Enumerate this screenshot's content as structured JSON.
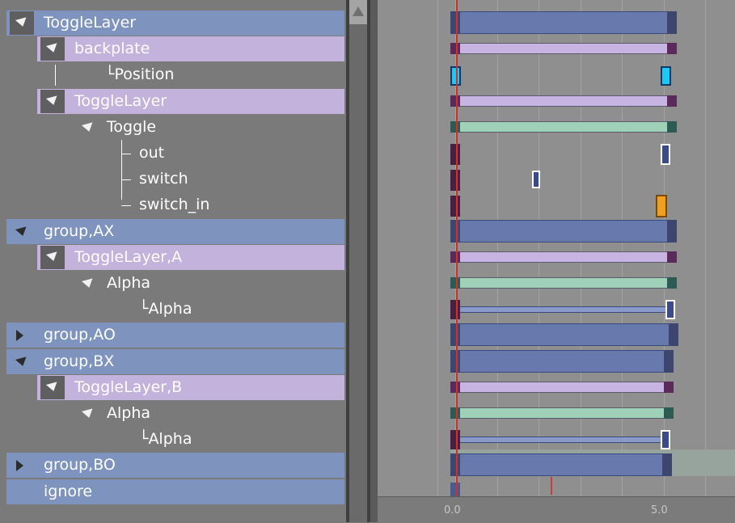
{
  "tree": {
    "rows": [
      {
        "label": "ToggleLayer",
        "style": "blue",
        "toggle": "box-down"
      },
      {
        "label": "backplate",
        "style": "purple",
        "toggle": "box-down"
      },
      {
        "label": "└Position",
        "style": "none",
        "toggle": "none"
      },
      {
        "label": "ToggleLayer",
        "style": "purple",
        "toggle": "box-down"
      },
      {
        "label": "Toggle",
        "style": "none",
        "toggle": "down"
      },
      {
        "label": "out",
        "style": "none",
        "toggle": "none"
      },
      {
        "label": "switch",
        "style": "none",
        "toggle": "none"
      },
      {
        "label": "switch_in",
        "style": "none",
        "toggle": "none"
      },
      {
        "label": "group,AX",
        "style": "blue",
        "toggle": "down"
      },
      {
        "label": "ToggleLayer,A",
        "style": "purple",
        "toggle": "box-down"
      },
      {
        "label": "Alpha",
        "style": "none",
        "toggle": "down"
      },
      {
        "label": "└Alpha",
        "style": "none",
        "toggle": "none"
      },
      {
        "label": "group,AO",
        "style": "blue",
        "toggle": "right"
      },
      {
        "label": "group,BX",
        "style": "blue",
        "toggle": "down"
      },
      {
        "label": "ToggleLayer,B",
        "style": "purple",
        "toggle": "box-down"
      },
      {
        "label": "Alpha",
        "style": "none",
        "toggle": "down"
      },
      {
        "label": "└Alpha",
        "style": "none",
        "toggle": "none"
      },
      {
        "label": "group,BO",
        "style": "blue",
        "toggle": "right"
      },
      {
        "label": "ignore",
        "style": "blue",
        "toggle": "none"
      }
    ]
  },
  "timeline": {
    "ruler": {
      "labels": [
        "0.0",
        "5.0"
      ]
    },
    "current_time_marker": "red"
  },
  "colors": {
    "layer_blue": "#7f93bf",
    "layer_purple": "#c3b2dc",
    "clip_blue": "#6779ad",
    "clip_purple": "#c7b4e2",
    "clip_green": "#9fd0b8",
    "playhead": "#cc3030",
    "key_cyan": "#1ec8f0",
    "key_orange": "#f0a020"
  }
}
